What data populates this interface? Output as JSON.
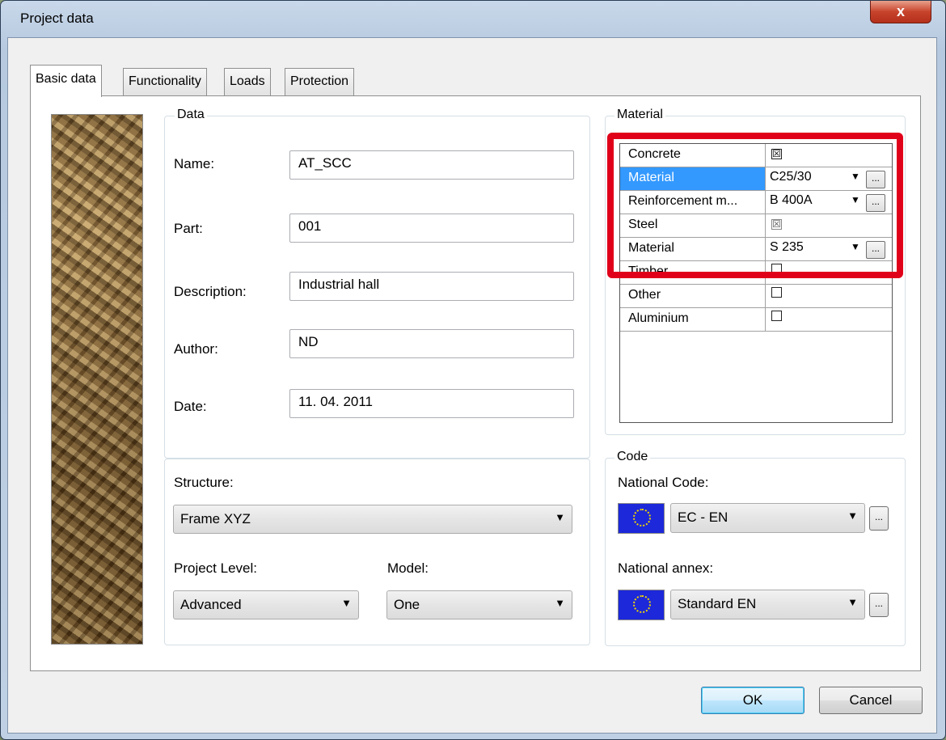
{
  "window": {
    "title": "Project data",
    "close_glyph": "x"
  },
  "tabs": [
    {
      "label": "Basic data",
      "active": true
    },
    {
      "label": "Functionality",
      "active": false
    },
    {
      "label": "Loads",
      "active": false
    },
    {
      "label": "Protection",
      "active": false
    }
  ],
  "data_group": {
    "title": "Data",
    "fields": [
      {
        "label": "Name:",
        "value": "AT_SCC"
      },
      {
        "label": "Part:",
        "value": "001"
      },
      {
        "label": "Description:",
        "value": "Industrial hall"
      },
      {
        "label": "Author:",
        "value": "ND"
      },
      {
        "label": "Date:",
        "value": "11. 04. 2011"
      }
    ]
  },
  "structure": {
    "label": "Structure:",
    "value": "Frame XYZ",
    "project_level_label": "Project Level:",
    "project_level_value": "Advanced",
    "model_label": "Model:",
    "model_value": "One"
  },
  "material": {
    "title": "Material",
    "rows": [
      {
        "name": "Concrete",
        "checkbox": "checked"
      },
      {
        "name": "Material",
        "value": "C25/30",
        "selected": true
      },
      {
        "name": "Reinforcement m...",
        "value": "B 400A"
      },
      {
        "name": "Steel",
        "checkbox": "checked"
      },
      {
        "name": "Material",
        "value": "S 235"
      },
      {
        "name": "Timber",
        "checkbox": "unchecked"
      },
      {
        "name": "Other",
        "checkbox": "unchecked"
      },
      {
        "name": "Aluminium",
        "checkbox": "unchecked"
      }
    ],
    "browse_glyph": "...",
    "check_glyph": "☒",
    "highlight_color": "#e0001a"
  },
  "code": {
    "title": "Code",
    "national_code_label": "National Code:",
    "national_code_value": "EC - EN",
    "national_annex_label": "National annex:",
    "national_annex_value": "Standard EN",
    "flag_icon": "eu-flag-icon"
  },
  "buttons": {
    "ok": "OK",
    "cancel": "Cancel"
  },
  "arrow_glyph": "▼"
}
